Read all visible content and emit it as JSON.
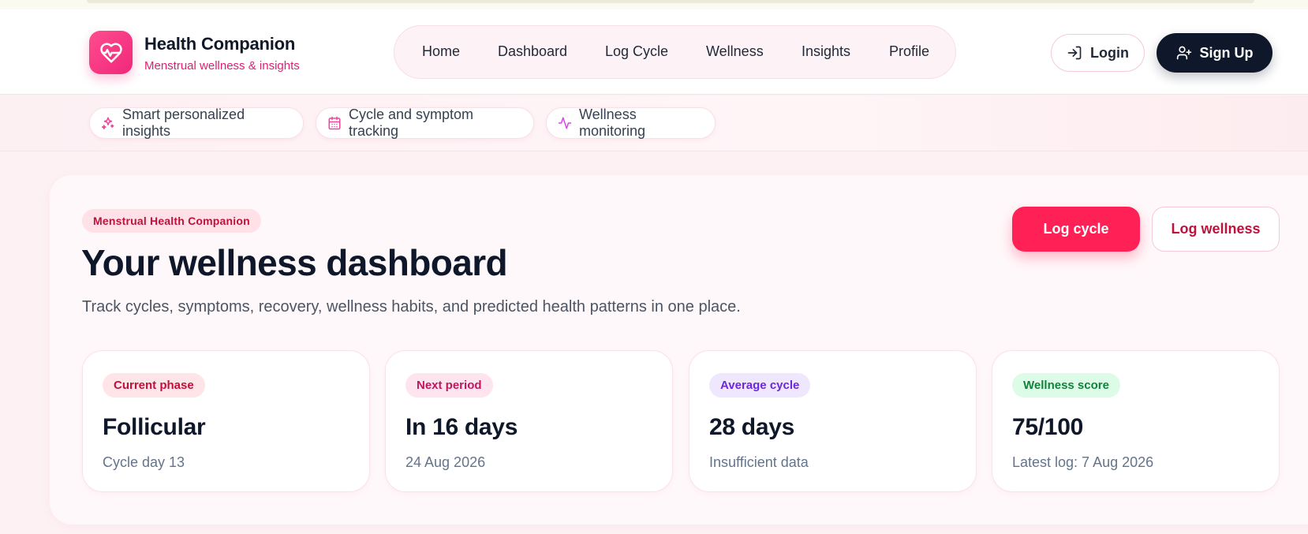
{
  "brand": {
    "title": "Health Companion",
    "subtitle": "Menstrual wellness & insights",
    "logo_icon": "heart-pulse-icon",
    "accent": "#f0277a"
  },
  "nav": {
    "items": [
      {
        "label": "Home"
      },
      {
        "label": "Dashboard"
      },
      {
        "label": "Log Cycle"
      },
      {
        "label": "Wellness"
      },
      {
        "label": "Insights"
      },
      {
        "label": "Profile"
      }
    ]
  },
  "auth": {
    "login_label": "Login",
    "login_icon": "login-icon",
    "signup_label": "Sign Up",
    "signup_icon": "user-plus-icon"
  },
  "features": [
    {
      "label": "Smart personalized insights",
      "icon": "sparkles-icon"
    },
    {
      "label": "Cycle and symptom tracking",
      "icon": "calendar-icon"
    },
    {
      "label": "Wellness monitoring",
      "icon": "activity-icon"
    }
  ],
  "hero": {
    "tag": "Menstrual Health Companion",
    "title": "Your wellness dashboard",
    "subtitle": "Track cycles, symptoms, recovery, wellness habits, and predicted health patterns in one place.",
    "primary_button": "Log cycle",
    "secondary_button": "Log wellness",
    "primary_color": "#ff2156"
  },
  "stats": [
    {
      "label": "Current phase",
      "value": "Follicular",
      "detail": "Cycle day 13",
      "pill_bg": "#ffe4e8",
      "pill_color": "#be123c"
    },
    {
      "label": "Next period",
      "value": "In 16 days",
      "detail": "24 Aug 2026",
      "pill_bg": "#fde4ef",
      "pill_color": "#be185d"
    },
    {
      "label": "Average cycle",
      "value": "28 days",
      "detail": "Insufficient data",
      "pill_bg": "#efe7fd",
      "pill_color": "#6d28d9"
    },
    {
      "label": "Wellness score",
      "value": "75/100",
      "detail": "Latest log: 7 Aug 2026",
      "pill_bg": "#dcfce7",
      "pill_color": "#15803d"
    }
  ]
}
